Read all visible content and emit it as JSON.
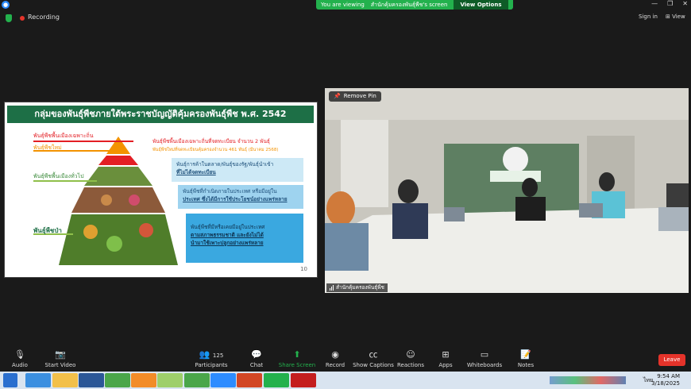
{
  "banner": {
    "viewing_prefix": "You are viewing",
    "viewing_name": "สำนักคุ้มครองพันธุ์พืช's screen",
    "view_options": "View Options"
  },
  "window": {
    "minimize": "—",
    "restore": "❐",
    "close": "✕"
  },
  "status": {
    "recording": "Recording",
    "sign_in": "Sign in",
    "view": "View"
  },
  "slide": {
    "title": "กลุ่มของพันธุ์พืชภายใต้พระราชบัญญัติคุ้มครองพันธุ์พืช พ.ศ. 2542",
    "label_local_specific": "พันธุ์พืชพื้นเมืองเฉพาะถิ่น",
    "label_new": "พันธุ์พืชใหม่",
    "label_local_general": "พันธุ์พืชพื้นเมืองทั่วไป",
    "label_wild": "พันธุ์พืชป่า",
    "note_local_specific": "พันธุ์พืชพื้นเมืองเฉพาะถิ่นที่จดทะเบียน จำนวน 2 พันธุ์",
    "note_new": "พันธุ์พืชใหม่ที่จดทะเบียนคุ้มครองจำนวน 461 พันธุ์ (มีนาคม 2568)",
    "box1_line1": "พันธุ์การค้าในตลาด/พันธุ์ของรัฐ/พันธุ์นำเข้า",
    "box1_line2": "ที่ไม่ได้จดทะเบียน",
    "box2_line1": "พันธุ์พืชที่กำเนิดภายในประเทศ หรือมีอยู่ใน",
    "box2_line2": "ประเทศ ซึ่งได้มีการใช้ประโยชน์อย่างแพร่หลาย",
    "box3_line1": "พันธุ์พืชที่มีหรือเคยมีอยู่ในประเทศ",
    "box3_line2": "ตามสภาพธรรมชาติ และยังไม่ได้",
    "box3_line3": "นำมาใช้เพาะปลูกอย่างแพร่หลาย",
    "page_number": "10"
  },
  "camera": {
    "remove_pin": "Remove Pin",
    "participant_name": "สำนักคุ้มครองพันธุ์พืช"
  },
  "toolbar": {
    "audio": "Audio",
    "start_video": "Start Video",
    "participants": "Participants",
    "participants_count": "125",
    "chat": "Chat",
    "share_screen": "Share Screen",
    "record": "Record",
    "show_captions": "Show Captions",
    "reactions": "Reactions",
    "apps": "Apps",
    "whiteboards": "Whiteboards",
    "notes": "Notes",
    "leave": "Leave"
  },
  "taskbar": {
    "time": "9:54 AM",
    "date": "3/18/2025",
    "lang": "ไทย"
  },
  "colors": {
    "zoom_green": "#23b14d",
    "leave_red": "#e5332a",
    "slide_header": "#1d6f46",
    "box_blue": "#3aa8e0"
  }
}
